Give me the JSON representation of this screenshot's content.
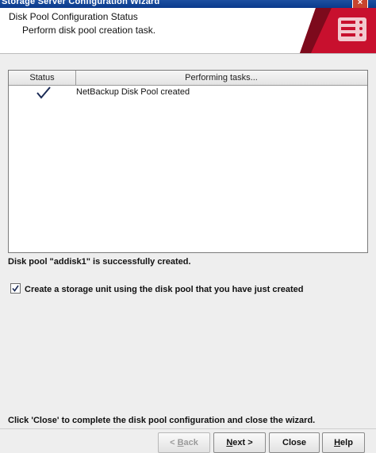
{
  "window": {
    "title": "Storage Server Configuration Wizard",
    "close_glyph": "×"
  },
  "header": {
    "title": "Disk Pool Configuration Status",
    "subtitle": "Perform disk pool creation task."
  },
  "table": {
    "columns": [
      "Status",
      "Performing tasks..."
    ],
    "rows": [
      {
        "status_icon": "checkmark-icon",
        "task": "NetBackup Disk Pool created"
      }
    ]
  },
  "message": "Disk pool \"addisk1\" is successfully created.",
  "checkbox": {
    "label": "Create a storage unit using the disk pool that you have just created",
    "checked": true
  },
  "hint": "Click 'Close' to complete the disk pool configuration and close the wizard.",
  "buttons": {
    "back_prefix": "< ",
    "back_mnemonic": "B",
    "back_rest": "ack",
    "next_mnemonic": "N",
    "next_rest": "ext >",
    "close": "Close",
    "help_mnemonic": "H",
    "help_rest": "elp"
  },
  "colors": {
    "titlebar": "#0a3a8c",
    "logo_red": "#c8102e"
  }
}
